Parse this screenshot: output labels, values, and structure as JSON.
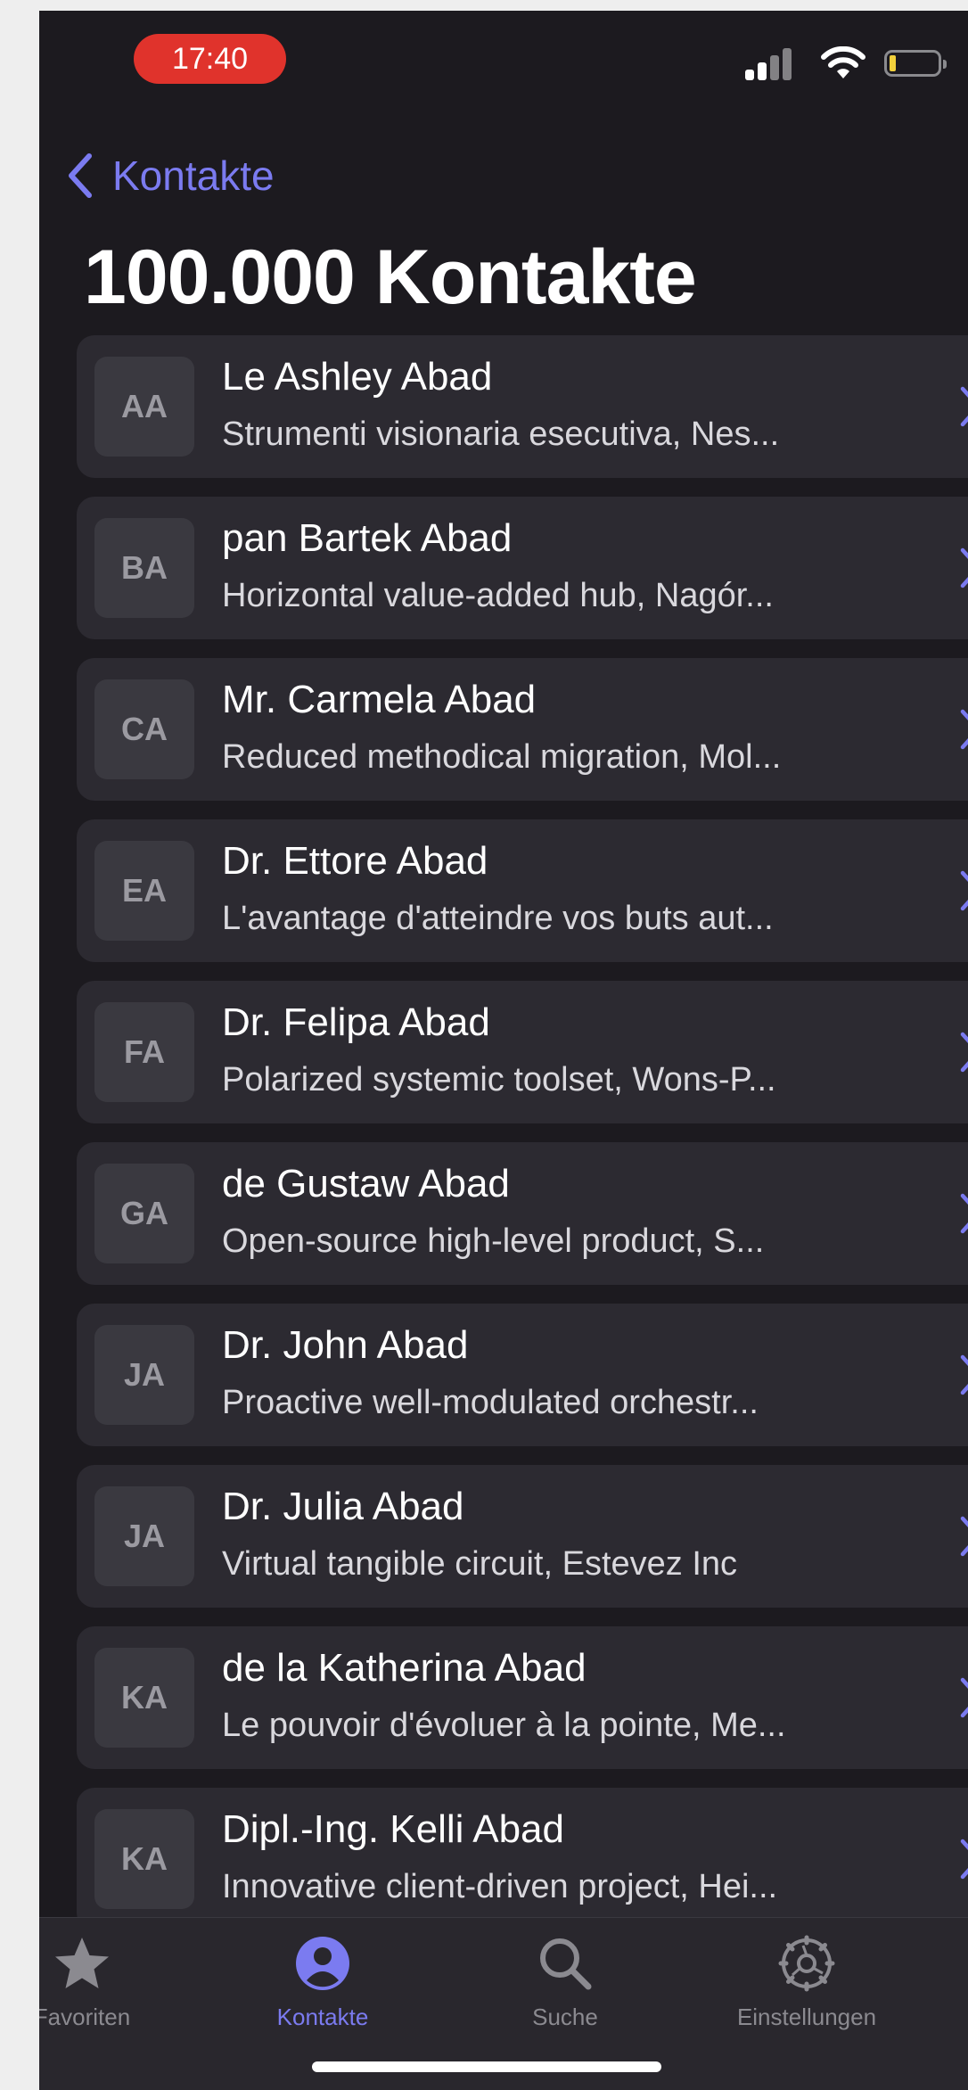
{
  "status": {
    "time": "17:40"
  },
  "nav": {
    "back_label": "Kontakte",
    "title": "100.000 Kontakte"
  },
  "contacts": [
    {
      "initials": "AA",
      "name": "Le Ashley Abad",
      "subtitle": "Strumenti visionaria esecutiva, Nes..."
    },
    {
      "initials": "BA",
      "name": "pan Bartek Abad",
      "subtitle": "Horizontal value-added hub, Nagór..."
    },
    {
      "initials": "CA",
      "name": "Mr. Carmela Abad",
      "subtitle": "Reduced methodical migration, Mol..."
    },
    {
      "initials": "EA",
      "name": "Dr. Ettore Abad",
      "subtitle": "L'avantage d'atteindre vos buts aut..."
    },
    {
      "initials": "FA",
      "name": "Dr. Felipa Abad",
      "subtitle": "Polarized systemic toolset, Wons-P..."
    },
    {
      "initials": "GA",
      "name": "de Gustaw Abad",
      "subtitle": "Open-source high-level product, S..."
    },
    {
      "initials": "JA",
      "name": "Dr. John Abad",
      "subtitle": "Proactive well-modulated orchestr..."
    },
    {
      "initials": "JA",
      "name": "Dr. Julia Abad",
      "subtitle": "Virtual tangible circuit, Estevez Inc"
    },
    {
      "initials": "KA",
      "name": "de la Katherina Abad",
      "subtitle": "Le pouvoir d'évoluer à la pointe, Me..."
    },
    {
      "initials": "KA",
      "name": "Dipl.-Ing. Kelli Abad",
      "subtitle": "Innovative client-driven project, Hei..."
    }
  ],
  "tabs": [
    {
      "label": "Favoriten",
      "icon": "star-icon",
      "active": false
    },
    {
      "label": "Kontakte",
      "icon": "person-circle-icon",
      "active": true
    },
    {
      "label": "Suche",
      "icon": "search-icon",
      "active": false
    },
    {
      "label": "Einstellungen",
      "icon": "gear-icon",
      "active": false
    }
  ],
  "colors": {
    "accent": "#7b7bf0",
    "background": "#1c1a1f",
    "row": "#2c2a31",
    "time_pill": "#e0332c"
  }
}
